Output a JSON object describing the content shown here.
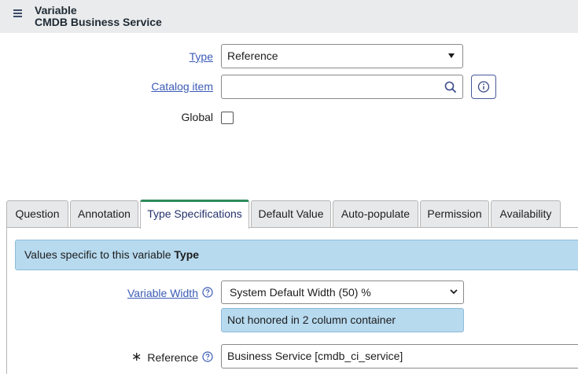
{
  "header": {
    "title": "Variable",
    "subtitle": "CMDB Business Service"
  },
  "form": {
    "type_label": "Type",
    "type_value": "Reference",
    "catalog_item_label": "Catalog item",
    "catalog_item_value": "",
    "global_label": "Global",
    "global_checked": false
  },
  "tabs": [
    {
      "label": "Question",
      "active": false
    },
    {
      "label": "Annotation",
      "active": false
    },
    {
      "label": "Type Specifications",
      "active": true
    },
    {
      "label": "Default Value",
      "active": false
    },
    {
      "label": "Auto-populate",
      "active": false
    },
    {
      "label": "Permission",
      "active": false
    },
    {
      "label": "Availability",
      "active": false
    }
  ],
  "type_spec": {
    "banner_text": "Values specific to this variable ",
    "banner_bold": "Type",
    "variable_width_label": "Variable Width",
    "variable_width_value": "System Default Width (50) %",
    "variable_width_note": "Not honored in 2 column container",
    "reference_label": "Reference",
    "reference_required_mark": "∗",
    "reference_value": "Business Service [cmdb_ci_service]"
  },
  "colors": {
    "accent_tab": "#2e8a5a",
    "link": "#3b5bb5",
    "info_bg": "#b7daef",
    "header_bg": "#e9ebed"
  },
  "icons": [
    "menu-icon",
    "search-icon",
    "info-icon",
    "help-icon",
    "chevron-down-icon",
    "caret-down-icon"
  ]
}
